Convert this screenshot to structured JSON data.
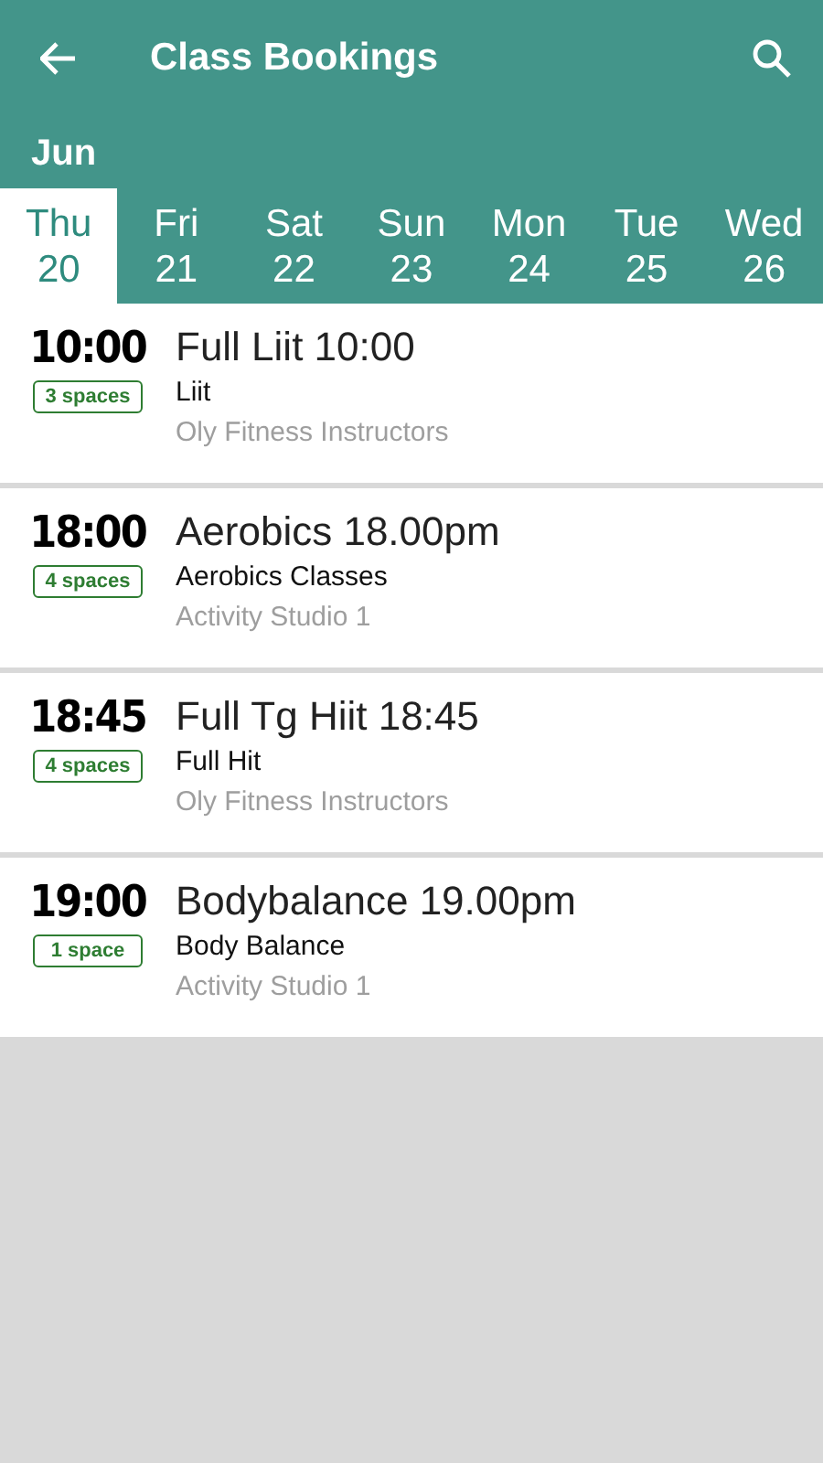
{
  "app_bar": {
    "title": "Class Bookings"
  },
  "month": "Jun",
  "days": [
    {
      "weekday": "Thu",
      "date": "20",
      "selected": true
    },
    {
      "weekday": "Fri",
      "date": "21",
      "selected": false
    },
    {
      "weekday": "Sat",
      "date": "22",
      "selected": false
    },
    {
      "weekday": "Sun",
      "date": "23",
      "selected": false
    },
    {
      "weekday": "Mon",
      "date": "24",
      "selected": false
    },
    {
      "weekday": "Tue",
      "date": "25",
      "selected": false
    },
    {
      "weekday": "Wed",
      "date": "26",
      "selected": false
    }
  ],
  "classes": [
    {
      "time": "10:00",
      "spaces": "3 spaces",
      "title": "Full Liit 10:00",
      "category": "Liit",
      "location": "Oly Fitness Instructors"
    },
    {
      "time": "18:00",
      "spaces": "4 spaces",
      "title": "Aerobics 18.00pm",
      "category": "Aerobics Classes",
      "location": "Activity Studio 1"
    },
    {
      "time": "18:45",
      "spaces": "4 spaces",
      "title": "Full Tg Hiit 18:45",
      "category": "Full Hit",
      "location": "Oly Fitness Instructors"
    },
    {
      "time": "19:00",
      "spaces": "1 space",
      "title": "Bodybalance 19.00pm",
      "category": "Body Balance",
      "location": "Activity Studio 1"
    }
  ]
}
